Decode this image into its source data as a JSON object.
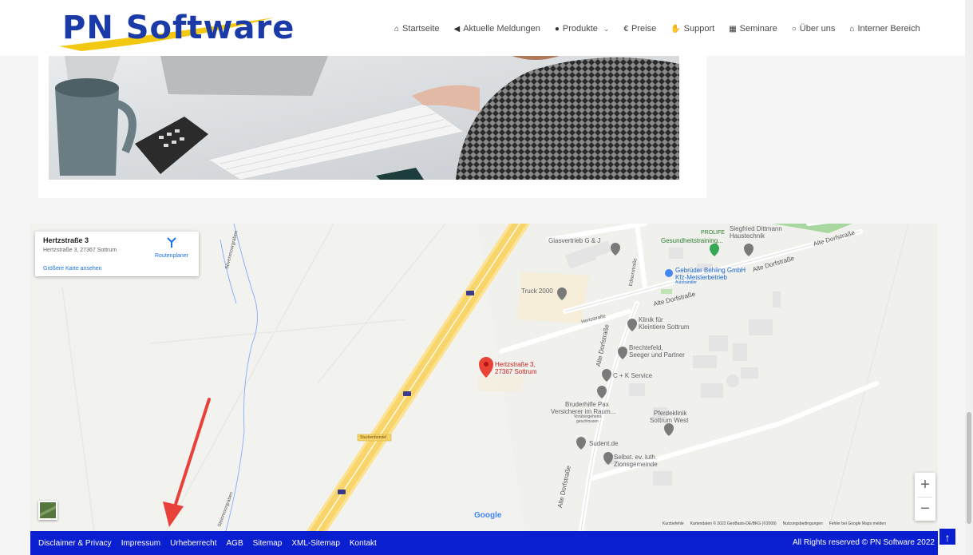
{
  "brand": {
    "logo_text": "PN Software"
  },
  "nav": [
    {
      "label": "Startseite",
      "icon": "home-icon",
      "glyph": "⌂"
    },
    {
      "label": "Aktuelle Meldungen",
      "icon": "megaphone-icon",
      "glyph": "◀"
    },
    {
      "label": "Produkte",
      "icon": "product-icon",
      "glyph": "●",
      "chevron": "⌄"
    },
    {
      "label": "Preise",
      "icon": "euro-icon",
      "glyph": "€"
    },
    {
      "label": "Support",
      "icon": "handshake-icon",
      "glyph": "✋"
    },
    {
      "label": "Seminare",
      "icon": "seminar-icon",
      "glyph": "▦"
    },
    {
      "label": "Über uns",
      "icon": "comment-icon",
      "glyph": "○"
    },
    {
      "label": "Interner Bereich",
      "icon": "house-lock-icon",
      "glyph": "⌂"
    }
  ],
  "map": {
    "info_title": "Hertzstraße 3",
    "info_address": "Hertzstraße 3, 27367 Sottrum",
    "larger_map_link": "Größere Karte ansehen",
    "route_label": "Routenplaner",
    "zoom_in": "+",
    "zoom_out": "−",
    "google": "Google",
    "footer_items": [
      "Kurzbefehle",
      "Kartendaten © 2022 GeoBasis-DE/BKG (©2009)",
      "Nutzungsbedingungen",
      "Fehler bei Google Maps melden"
    ],
    "labels": {
      "glasvertrieb": "Glasvertrieb G & J",
      "prolife": "PROLIFE",
      "gesundheit": "Gesundheitstraining...",
      "siegfried": "Siegfried Dittmann Haustechnik",
      "behling_1": "Gebrüder Behling GmbH",
      "behling_2": "Kfz-Meisterbetrieb",
      "behling_3": "Autohändler",
      "truck": "Truck 2000",
      "klinik_1": "Klinik für",
      "klinik_2": "Kleintiere Sottrum",
      "brechtefeld_1": "Brechtefeld,",
      "brechtefeld_2": "Seeger und Partner",
      "marker_1": "Hertzstraße 3,",
      "marker_2": "27367 Sottrum",
      "ck": "C + K Service",
      "bruderhilfe_1": "Bruderhilfe Pax",
      "bruderhilfe_2": "Versicherer im Raum...",
      "bruderhilfe_3": "Vorübergehend",
      "bruderhilfe_4": "geschlossen",
      "pferdeklinik_1": "Pferdeklinik",
      "pferdeklinik_2": "Sottrum West",
      "sudent": "Sudent.de",
      "selbst_1": "Selbst. ev. luth.",
      "selbst_2": "Zionsgemeinde",
      "road_alte_1": "Alte Dorfstraße",
      "road_alte_2": "Alte Dorfstraße",
      "road_alte_3": "Alte Dorfstraße",
      "road_alte_4": "Alte Dorfstraße",
      "road_alte_5": "Alte Dorfstraße",
      "road_hertz": "Hertzstraße",
      "road_edison": "Edisonstraße",
      "road_soeven": "Sövenmoorgraben",
      "road_steinmoor": "Steinmoorgraben",
      "road_stucken": "Stuckenborstel"
    }
  },
  "footer": {
    "links": [
      "Disclaimer & Privacy",
      "Impressum",
      "Urheberrecht",
      "AGB",
      "Sitemap",
      "XML-Sitemap",
      "Kontakt"
    ],
    "copyright": "All Rights reserved © PN Software 2022",
    "back_to_top": "↑"
  },
  "colors": {
    "brand_blue": "#1a3aa8",
    "footer_blue": "#0a1fd0",
    "accent_yellow": "#f2c811",
    "marker_red": "#ea4335"
  }
}
